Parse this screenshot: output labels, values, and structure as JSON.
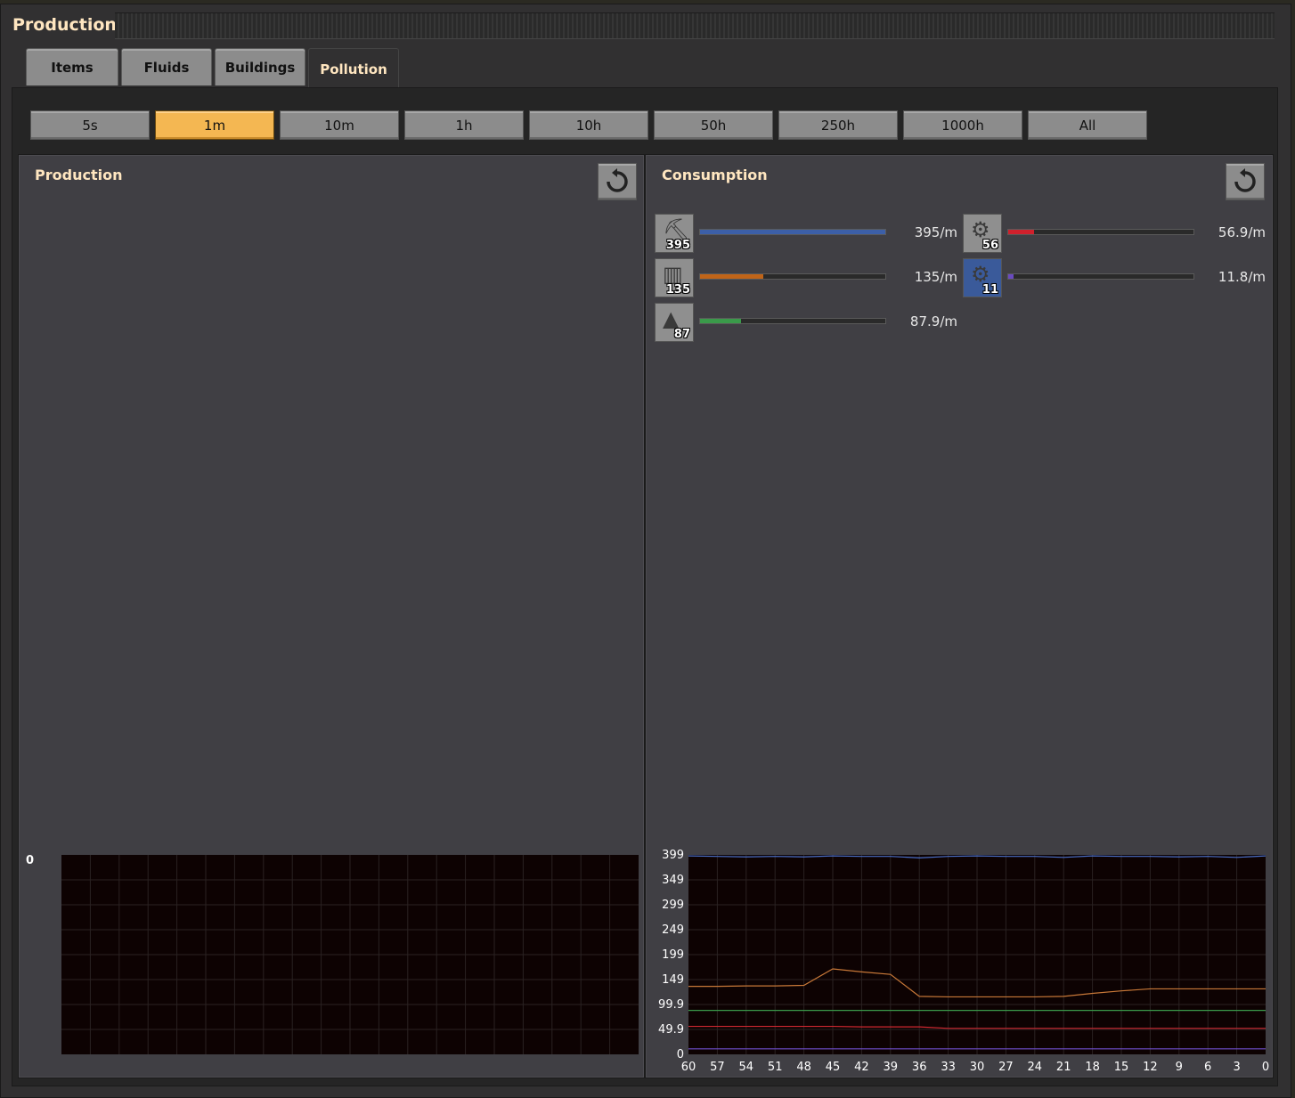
{
  "window": {
    "title": "Production"
  },
  "tabs": [
    {
      "label": "Items",
      "active": false
    },
    {
      "label": "Fluids",
      "active": false
    },
    {
      "label": "Buildings",
      "active": false
    },
    {
      "label": "Pollution",
      "active": true
    }
  ],
  "time_buttons": [
    {
      "label": "5s",
      "active": false
    },
    {
      "label": "1m",
      "active": true
    },
    {
      "label": "10m",
      "active": false
    },
    {
      "label": "1h",
      "active": false
    },
    {
      "label": "10h",
      "active": false
    },
    {
      "label": "50h",
      "active": false
    },
    {
      "label": "250h",
      "active": false
    },
    {
      "label": "1000h",
      "active": false
    },
    {
      "label": "All",
      "active": false
    }
  ],
  "production": {
    "title": "Production",
    "reset_icon": "reset-icon",
    "chart_y_label": "0"
  },
  "consumption": {
    "title": "Consumption",
    "reset_icon": "reset-icon",
    "entries": [
      {
        "icon": "mining-drill-icon",
        "count": "395",
        "rate": "395/m",
        "fill": 1.0,
        "color": "#3c5fa8"
      },
      {
        "icon": "stone-furnace-icon",
        "count": "135",
        "rate": "135/m",
        "fill": 0.34,
        "color": "#c06418"
      },
      {
        "icon": "boiler-icon",
        "count": "87",
        "rate": "87.9/m",
        "fill": 0.22,
        "color": "#3a9a4a"
      },
      {
        "icon": "assembling-machine-1-icon",
        "count": "56",
        "rate": "56.9/m",
        "fill": 0.14,
        "color": "#d0202c"
      },
      {
        "icon": "assembling-machine-2-icon",
        "count": "11",
        "rate": "11.8/m",
        "fill": 0.03,
        "color": "#6a4ac0"
      }
    ]
  },
  "chart_data": {
    "type": "line",
    "ylim": [
      0,
      399
    ],
    "y_ticks": [
      "399",
      "349",
      "299",
      "249",
      "199",
      "149",
      "99.9",
      "49.9",
      "0"
    ],
    "x_ticks": [
      "60",
      "57",
      "54",
      "51",
      "48",
      "45",
      "42",
      "39",
      "36",
      "33",
      "30",
      "27",
      "24",
      "21",
      "18",
      "15",
      "12",
      "9",
      "6",
      "3",
      "0"
    ],
    "x": [
      60,
      57,
      54,
      51,
      48,
      45,
      42,
      39,
      36,
      33,
      30,
      27,
      24,
      21,
      18,
      15,
      12,
      9,
      6,
      3,
      0
    ],
    "series": [
      {
        "color": "#4a6fc8",
        "values": [
          397,
          396,
          395,
          396,
          395,
          397,
          396,
          396,
          393,
          396,
          397,
          396,
          396,
          394,
          397,
          396,
          396,
          395,
          396,
          394,
          397
        ]
      },
      {
        "color": "#c87838",
        "values": [
          136,
          136,
          137,
          137,
          138,
          171,
          165,
          160,
          116,
          115,
          115,
          115,
          115,
          116,
          122,
          127,
          131,
          131,
          131,
          131,
          131
        ]
      },
      {
        "color": "#3a9a4a",
        "values": [
          88,
          88,
          88,
          88,
          88,
          88,
          88,
          88,
          88,
          88,
          88,
          88,
          88,
          88,
          88,
          88,
          88,
          88,
          88,
          88,
          88
        ]
      },
      {
        "color": "#d02830",
        "values": [
          56,
          56,
          56,
          56,
          56,
          56,
          55,
          55,
          55,
          52,
          52,
          52,
          52,
          52,
          52,
          52,
          52,
          52,
          52,
          52,
          52
        ]
      },
      {
        "color": "#7050d0",
        "values": [
          11,
          11,
          11,
          11,
          11,
          11,
          11,
          11,
          11,
          11,
          11,
          11,
          11,
          11,
          11,
          11,
          11,
          11,
          11,
          11,
          11
        ]
      }
    ]
  }
}
